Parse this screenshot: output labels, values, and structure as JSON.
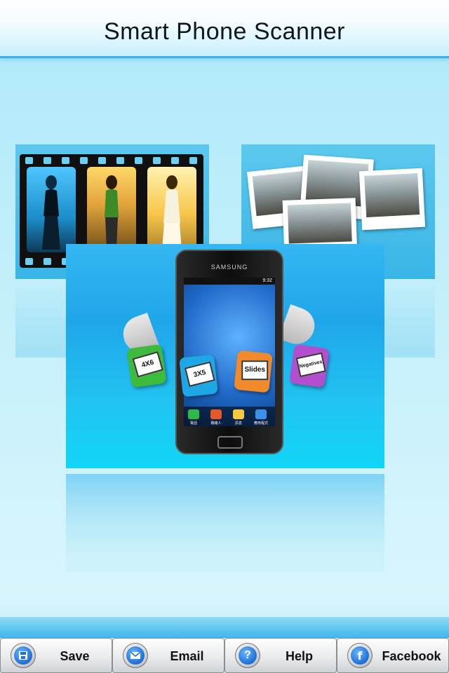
{
  "header": {
    "title": "Smart Phone Scanner"
  },
  "hero": {
    "phone_brand": "SAMSUNG",
    "status_time": "9:32",
    "dock": [
      "電話",
      "聯絡人",
      "訊息",
      "應用程式"
    ],
    "cards": [
      {
        "label": "4X6",
        "color": "#3dbb3d"
      },
      {
        "label": "3X5",
        "color": "#1ea7e6"
      },
      {
        "label": "Slides",
        "color": "#f18a2b"
      },
      {
        "label": "Negatives",
        "color": "#b34fcf"
      }
    ]
  },
  "toolbar": {
    "buttons": [
      {
        "label": "Save",
        "icon": "floppy-disk-icon"
      },
      {
        "label": "Email",
        "icon": "envelope-icon"
      },
      {
        "label": "Help",
        "icon": "question-mark-icon"
      },
      {
        "label": "Facebook",
        "icon": "facebook-f-icon"
      }
    ]
  }
}
